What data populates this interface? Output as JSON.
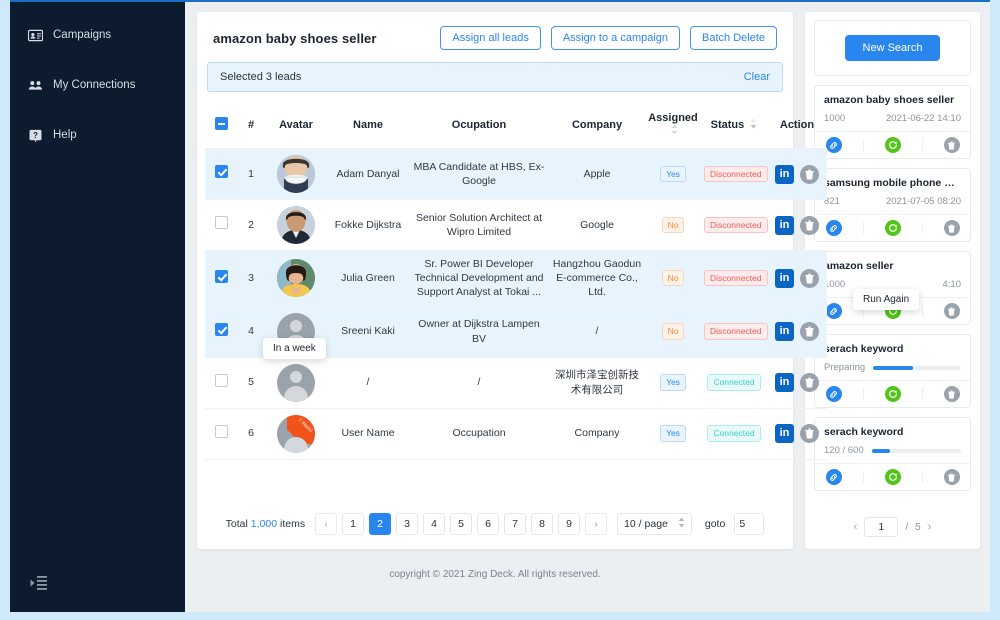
{
  "sidebar": {
    "items": [
      {
        "label": "Campaigns",
        "icon": "campaigns-icon"
      },
      {
        "label": "My Connections",
        "icon": "connections-icon"
      },
      {
        "label": "Help",
        "icon": "help-icon"
      }
    ],
    "collapse_icon": "collapse-menu-icon",
    "bg_color": "#0d1b2e"
  },
  "main": {
    "title": "amazon baby shoes seller",
    "buttons": {
      "assign_all": "Assign all leads",
      "assign_campaign": "Assign to a campaign",
      "batch_delete": "Batch Delete"
    },
    "selection_banner": {
      "text": "Selected 3 leads",
      "clear": "Clear"
    },
    "table": {
      "headers": {
        "checkbox": "",
        "num": "#",
        "avatar": "Avatar",
        "name": "Name",
        "occupation": "Ocupation",
        "company": "Company",
        "assigned": "Assigned",
        "status": "Status",
        "action": "Action"
      },
      "rows": [
        {
          "num": "1",
          "selected": true,
          "avatar_type": "photo-mask",
          "name": "Adam Danyal",
          "occupation": "MBA Candidate at HBS, Ex-Google",
          "company": "Apple",
          "assigned": "Yes",
          "assigned_kind": "yes",
          "status": "Disconnected",
          "status_kind": "disconnected"
        },
        {
          "num": "2",
          "selected": false,
          "avatar_type": "photo-suit",
          "name": "Fokke Dijkstra",
          "occupation": "Senior Solution Architect at Wipro Limited",
          "company": "Google",
          "assigned": "No",
          "assigned_kind": "no",
          "status": "Disconnected",
          "status_kind": "disconnected"
        },
        {
          "num": "3",
          "selected": true,
          "avatar_type": "photo-yellow",
          "name": "Julia Green",
          "occupation": "Sr. Power BI Developer Technical Development and Support Analyst at Tokai  ...",
          "company": "Hangzhou Gaodun E-commerce Co., Ltd.",
          "assigned": "No",
          "assigned_kind": "no",
          "status": "Disconnected",
          "status_kind": "disconnected"
        },
        {
          "num": "4",
          "selected": true,
          "avatar_type": "placeholder",
          "name": "Sreeni Kaki",
          "occupation": "Owner at Dijkstra Lampen BV",
          "company": "/",
          "assigned": "No",
          "assigned_kind": "no",
          "status": "Disconnected",
          "status_kind": "disconnected"
        },
        {
          "num": "5",
          "selected": false,
          "avatar_type": "placeholder",
          "name": "/",
          "occupation": "/",
          "company": "深圳市泽宝创新技术有限公司",
          "assigned": "Yes",
          "assigned_kind": "yes",
          "status": "Connected",
          "status_kind": "connected"
        },
        {
          "num": "6",
          "selected": false,
          "avatar_type": "placeholder-ribbon",
          "ribbon": "1 day(s)",
          "name": "User Name",
          "occupation": "Occupation",
          "company": "Company",
          "assigned": "Yes",
          "assigned_kind": "yes",
          "status": "Connected",
          "status_kind": "connected"
        }
      ],
      "action_icons": {
        "linkedin": "in",
        "delete": "trash-icon"
      }
    },
    "tooltip_in_a_week": "In a week",
    "pagination": {
      "total_prefix": "Total",
      "total_count": "1,000",
      "total_suffix": "items",
      "prev": "‹",
      "next": "›",
      "pages": [
        "1",
        "2",
        "3",
        "4",
        "5",
        "6",
        "7",
        "8",
        "9"
      ],
      "current": "2",
      "page_size": "10 / page",
      "goto_label": "goto",
      "goto_value": "5"
    }
  },
  "footer": {
    "text": "copyright © 2021 Zing Deck. All rights reserved."
  },
  "right_panel": {
    "new_search": "New Search",
    "cards": [
      {
        "title": "amazon baby shoes seller",
        "left": "1000",
        "right": "2021-06-22 14:10",
        "kind": "meta"
      },
      {
        "title": "samsung mobile phone XX...",
        "left": "821",
        "right": "2021-07-05 08:20",
        "kind": "meta"
      },
      {
        "title": "amazon seller",
        "left": "1000",
        "right": "4:10",
        "kind": "meta"
      },
      {
        "title": "serach keyword",
        "left": "Preparing",
        "progress": 45,
        "kind": "progress"
      },
      {
        "title": "serach keyword",
        "left": "120 / 600",
        "progress": 20,
        "kind": "progress"
      }
    ],
    "card_icons": {
      "link": "link-icon",
      "run": "run-again-icon",
      "delete": "trash-icon"
    },
    "tooltip_run_again": "Run Again",
    "pager": {
      "prev": "‹",
      "current": "1",
      "sep": "/",
      "total": "5",
      "next": "›"
    }
  },
  "colors": {
    "accent": "#2a86ef",
    "sidebar": "#0d1b2e",
    "page_bg": "#cfe8fa",
    "green": "#52c41a",
    "orange": "#f08b3a",
    "red": "#f05a5a",
    "teal": "#36cfc9"
  }
}
